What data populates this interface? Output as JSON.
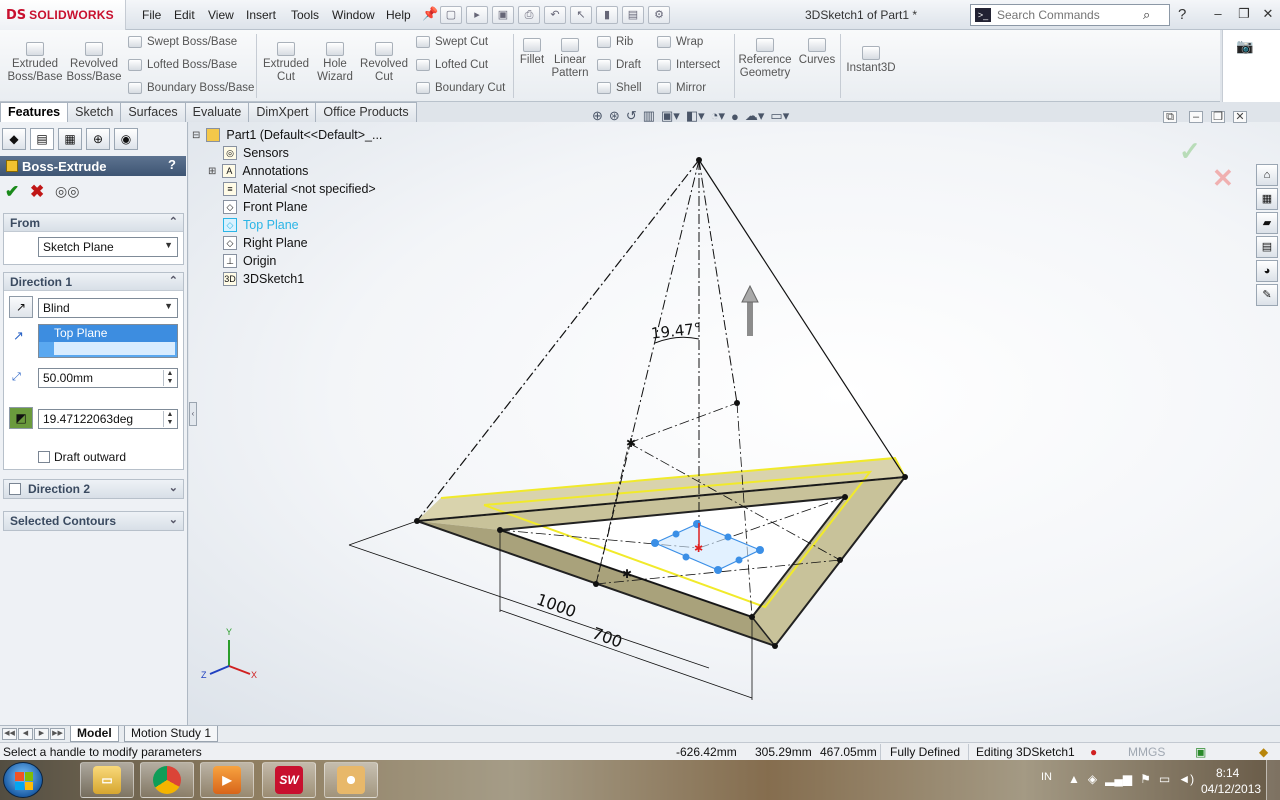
{
  "app": {
    "brand_prefix": "DS",
    "brand": "SOLIDWORKS",
    "doc_title": "3DSketch1 of Part1 *"
  },
  "menu": [
    "File",
    "Edit",
    "View",
    "Insert",
    "Tools",
    "Window",
    "Help"
  ],
  "search": {
    "placeholder": "Search Commands"
  },
  "commands": {
    "extruded_boss": "Extruded Boss/Base",
    "revolved_boss": "Revolved Boss/Base",
    "swept_boss": "Swept Boss/Base",
    "lofted_boss": "Lofted Boss/Base",
    "boundary_boss": "Boundary Boss/Base",
    "extruded_cut": "Extruded Cut",
    "hole_wizard": "Hole Wizard",
    "revolved_cut": "Revolved Cut",
    "swept_cut": "Swept Cut",
    "lofted_cut": "Lofted Cut",
    "boundary_cut": "Boundary Cut",
    "fillet": "Fillet",
    "linear_pattern": "Linear Pattern",
    "rib": "Rib",
    "draft": "Draft",
    "shell": "Shell",
    "wrap": "Wrap",
    "intersect": "Intersect",
    "mirror": "Mirror",
    "reference_geometry": "Reference Geometry",
    "curves": "Curves",
    "instant3d": "Instant3D"
  },
  "tabs": [
    "Features",
    "Sketch",
    "Surfaces",
    "Evaluate",
    "DimXpert",
    "Office Products"
  ],
  "property_manager": {
    "title": "Boss-Extrude",
    "help": "?",
    "from": {
      "label": "From",
      "value": "Sketch Plane"
    },
    "direction1": {
      "label": "Direction 1",
      "end_condition": "Blind",
      "direction_ref": "Top Plane",
      "depth": "50.00mm",
      "draft_angle": "19.47122063deg",
      "draft_outward": "Draft outward"
    },
    "direction2": {
      "label": "Direction 2"
    },
    "selected_contours": {
      "label": "Selected Contours"
    }
  },
  "tree": {
    "root": "Part1  (Default<<Default>_...",
    "items": [
      "Sensors",
      "Annotations",
      "Material <not specified>",
      "Front Plane",
      "Top Plane",
      "Right Plane",
      "Origin",
      "3DSketch1"
    ]
  },
  "dimensions": {
    "angle": "19.47°",
    "dim1": "1000",
    "dim2": "700"
  },
  "triad": {
    "x": "X",
    "y": "Y",
    "z": "Z"
  },
  "bottom_tabs": [
    "Model",
    "Motion Study 1"
  ],
  "status": {
    "hint": "Select a handle to modify parameters",
    "x": "-626.42mm",
    "y": "305.29mm",
    "z": "467.05mm",
    "state": "Fully Defined",
    "editing": "Editing 3DSketch1",
    "units": "MMGS"
  },
  "taskbar": {
    "lang": "IN",
    "time": "8:14",
    "date": "04/12/2013",
    "solidworks_icon_text": "SW"
  },
  "colors": {
    "accent": "#c8102e",
    "highlight": "#2bb5e6",
    "pm_header": "#4b6282"
  }
}
